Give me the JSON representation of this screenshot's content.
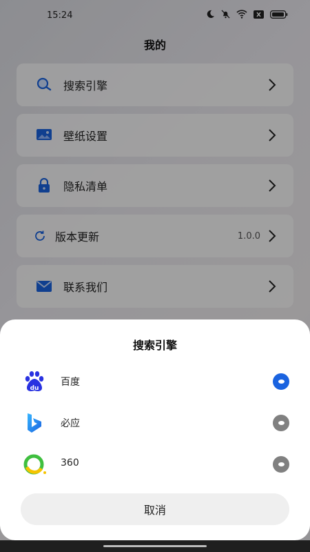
{
  "status": {
    "time": "15:24"
  },
  "header": {
    "title": "我的"
  },
  "menu": {
    "items": [
      {
        "label": "搜索引擎",
        "icon": "search-icon"
      },
      {
        "label": "壁纸设置",
        "icon": "wallpaper-icon"
      },
      {
        "label": "隐私清单",
        "icon": "lock-icon"
      },
      {
        "label": "版本更新",
        "icon": "refresh-icon",
        "value": "1.0.0"
      },
      {
        "label": "联系我们",
        "icon": "mail-icon"
      }
    ]
  },
  "sheet": {
    "title": "搜索引擎",
    "engines": [
      {
        "label": "百度",
        "icon": "baidu-icon",
        "selected": true
      },
      {
        "label": "必应",
        "icon": "bing-icon",
        "selected": false
      },
      {
        "label": "360",
        "icon": "360-icon",
        "selected": false
      }
    ],
    "cancel_label": "取消"
  },
  "colors": {
    "accent": "#1a63e0",
    "radio_off": "#808080"
  }
}
